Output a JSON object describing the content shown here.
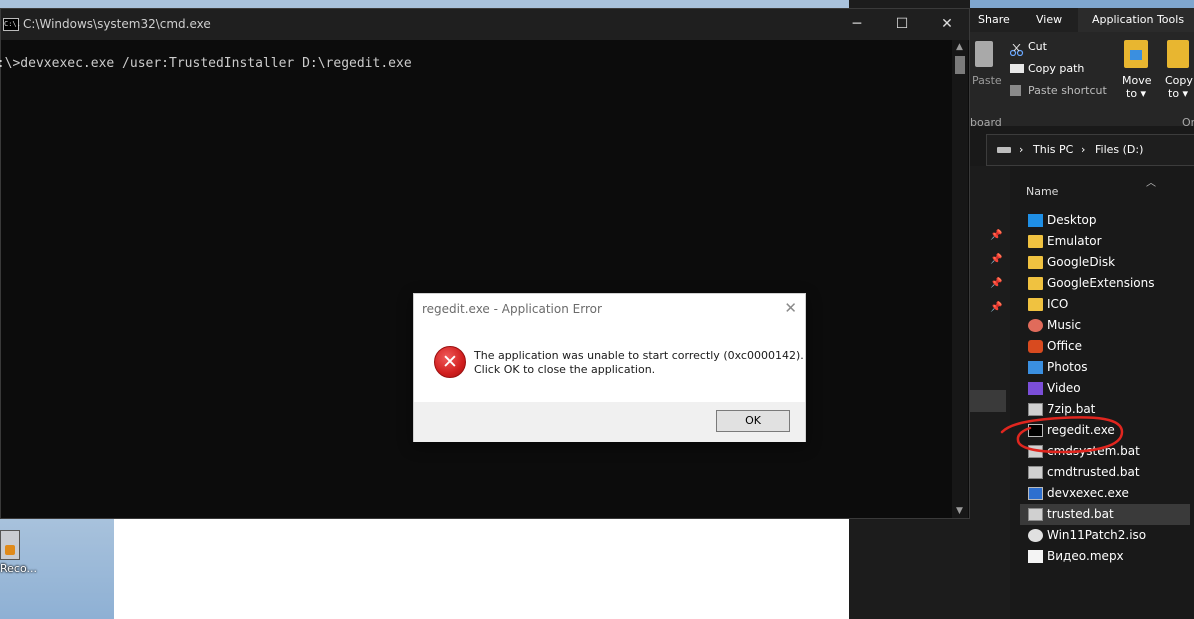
{
  "desktop": {
    "icon_label": "Reco..."
  },
  "cmd": {
    "title": "C:\\Windows\\system32\\cmd.exe",
    "icon_text": "C:\\.",
    "minimize": "─",
    "maximize": "☐",
    "close": "✕",
    "line": "D:\\>devxexec.exe /user:TrustedInstaller D:\\regedit.exe"
  },
  "dialog": {
    "title": "regedit.exe - Application Error",
    "message_line1": "The application was unable to start correctly (0xc0000142).",
    "message_line2": "Click OK to close the application.",
    "ok_label": "OK",
    "close": "✕",
    "error_glyph": "✕"
  },
  "explorer": {
    "tabs": [
      "Share",
      "View",
      "Application Tools"
    ],
    "ribbon": {
      "paste": "Paste",
      "cut": "Cut",
      "copy_path": "Copy path",
      "paste_shortcut": "Paste shortcut",
      "move_to_1": "Move",
      "move_to_2": "to ▾",
      "copy_to_1": "Copy",
      "copy_to_2": "to ▾",
      "clipboard_group": "board",
      "organize_group": "Or"
    },
    "breadcrumb": [
      "This PC",
      "Files (D:)"
    ],
    "column_name": "Name",
    "files": [
      {
        "name": "Desktop",
        "icon": "desktop-icon"
      },
      {
        "name": "Emulator",
        "icon": "folder-icon"
      },
      {
        "name": "GoogleDisk",
        "icon": "folder-icon"
      },
      {
        "name": "GoogleExtensions",
        "icon": "folder-icon"
      },
      {
        "name": "ICO",
        "icon": "folder-icon"
      },
      {
        "name": "Music",
        "icon": "music-icon"
      },
      {
        "name": "Office",
        "icon": "office-icon"
      },
      {
        "name": "Photos",
        "icon": "photos-icon"
      },
      {
        "name": "Video",
        "icon": "video-icon"
      },
      {
        "name": "7zip.bat",
        "icon": "batch-file-icon"
      },
      {
        "name": "regedit.exe",
        "icon": "console-app-icon"
      },
      {
        "name": "cmdsystem.bat",
        "icon": "batch-file-icon"
      },
      {
        "name": "cmdtrusted.bat",
        "icon": "batch-file-icon"
      },
      {
        "name": "devxexec.exe",
        "icon": "exe-icon"
      },
      {
        "name": "trusted.bat",
        "icon": "batch-file-icon"
      },
      {
        "name": "Win11Patch2.iso",
        "icon": "disc-image-icon"
      },
      {
        "name": "Видео.mepx",
        "icon": "file-icon"
      }
    ],
    "selected_file": "trusted.bat"
  },
  "colors": {
    "annotation": "#e0261f",
    "cmd_bg": "#0c0c0c",
    "explorer_bg": "#191919"
  }
}
